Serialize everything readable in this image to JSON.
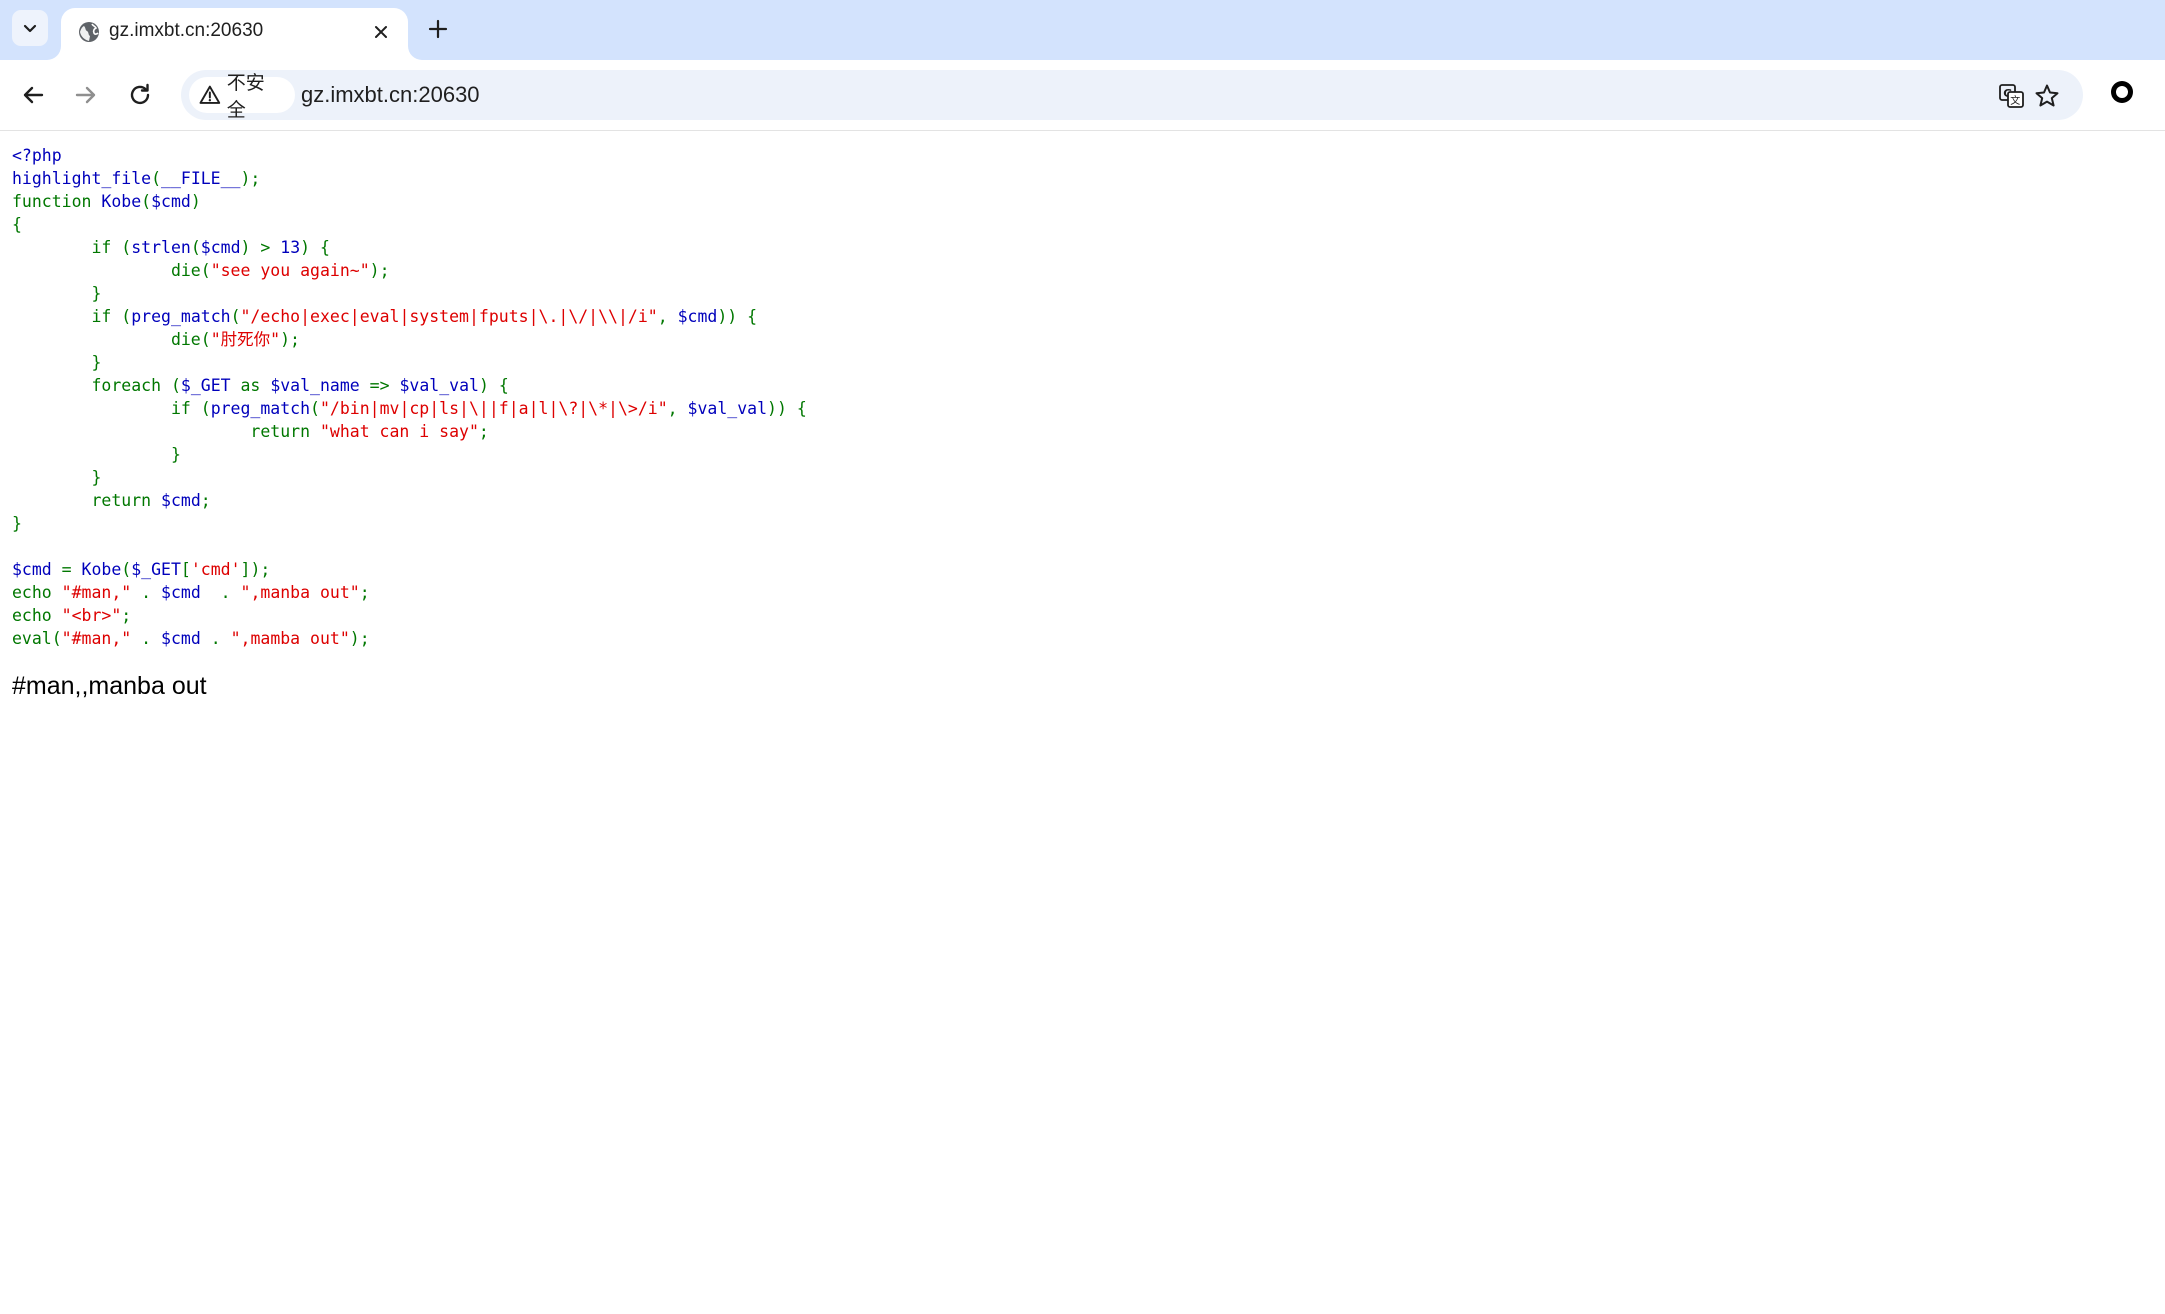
{
  "browser": {
    "tab": {
      "title": "gz.imxbt.cn:20630"
    },
    "address_bar": {
      "security_label": "不安全",
      "url": "gz.imxbt.cn:20630"
    },
    "icons": [
      "tab-search-icon",
      "globe-icon",
      "close-icon",
      "plus-icon",
      "back-icon",
      "forward-icon",
      "reload-icon",
      "warning-icon",
      "translate-icon",
      "star-icon",
      "profile-icon"
    ]
  },
  "colors": {
    "tabstrip_bg": "#d3e3fd",
    "omnibox_bg": "#edf2fa",
    "php_default": "#0000bb",
    "php_keyword": "#007700",
    "php_string": "#dd0000"
  },
  "code": {
    "lines": [
      [
        [
          "d",
          "<?php"
        ]
      ],
      [
        [
          "d",
          "highlight_file"
        ],
        [
          "k",
          "("
        ],
        [
          "d",
          "__FILE__"
        ],
        [
          "k",
          ");"
        ]
      ],
      [
        [
          "k",
          "function "
        ],
        [
          "d",
          "Kobe"
        ],
        [
          "k",
          "("
        ],
        [
          "d",
          "$cmd"
        ],
        [
          "k",
          ")"
        ]
      ],
      [
        [
          "k",
          "{"
        ]
      ],
      [
        [
          "k",
          "        if ("
        ],
        [
          "d",
          "strlen"
        ],
        [
          "k",
          "("
        ],
        [
          "d",
          "$cmd"
        ],
        [
          "k",
          ") > "
        ],
        [
          "d",
          "13"
        ],
        [
          "k",
          ") {"
        ]
      ],
      [
        [
          "k",
          "                die("
        ],
        [
          "s",
          "\"see you again~\""
        ],
        [
          "k",
          ");"
        ]
      ],
      [
        [
          "k",
          "        }"
        ]
      ],
      [
        [
          "k",
          "        if ("
        ],
        [
          "d",
          "preg_match"
        ],
        [
          "k",
          "("
        ],
        [
          "s",
          "\"/echo|exec|eval|system|fputs|\\.|\\/|\\\\|/i\""
        ],
        [
          "k",
          ", "
        ],
        [
          "d",
          "$cmd"
        ],
        [
          "k",
          ")) {"
        ]
      ],
      [
        [
          "k",
          "                die("
        ],
        [
          "s",
          "\"肘死你\""
        ],
        [
          "k",
          ");"
        ]
      ],
      [
        [
          "k",
          "        }"
        ]
      ],
      [
        [
          "k",
          "        foreach ("
        ],
        [
          "d",
          "$_GET "
        ],
        [
          "k",
          "as "
        ],
        [
          "d",
          "$val_name "
        ],
        [
          "k",
          "=> "
        ],
        [
          "d",
          "$val_val"
        ],
        [
          "k",
          ") {"
        ]
      ],
      [
        [
          "k",
          "                if ("
        ],
        [
          "d",
          "preg_match"
        ],
        [
          "k",
          "("
        ],
        [
          "s",
          "\"/bin|mv|cp|ls|\\||f|a|l|\\?|\\*|\\>/i\""
        ],
        [
          "k",
          ", "
        ],
        [
          "d",
          "$val_val"
        ],
        [
          "k",
          ")) {"
        ]
      ],
      [
        [
          "k",
          "                        return "
        ],
        [
          "s",
          "\"what can i say\""
        ],
        [
          "k",
          ";"
        ]
      ],
      [
        [
          "k",
          "                }"
        ]
      ],
      [
        [
          "k",
          "        }"
        ]
      ],
      [
        [
          "k",
          "        return "
        ],
        [
          "d",
          "$cmd"
        ],
        [
          "k",
          ";"
        ]
      ],
      [
        [
          "k",
          "}"
        ]
      ],
      [],
      [
        [
          "d",
          "$cmd "
        ],
        [
          "k",
          "= "
        ],
        [
          "d",
          "Kobe"
        ],
        [
          "k",
          "("
        ],
        [
          "d",
          "$_GET"
        ],
        [
          "k",
          "["
        ],
        [
          "s",
          "'cmd'"
        ],
        [
          "k",
          "]);"
        ]
      ],
      [
        [
          "k",
          "echo "
        ],
        [
          "s",
          "\"#man,\" "
        ],
        [
          "k",
          ". "
        ],
        [
          "d",
          "$cmd  "
        ],
        [
          "k",
          ". "
        ],
        [
          "s",
          "\",manba out\""
        ],
        [
          "k",
          ";"
        ]
      ],
      [
        [
          "k",
          "echo "
        ],
        [
          "s",
          "\"<br>\""
        ],
        [
          "k",
          ";"
        ]
      ],
      [
        [
          "k",
          "eval("
        ],
        [
          "s",
          "\"#man,\" "
        ],
        [
          "k",
          ". "
        ],
        [
          "d",
          "$cmd "
        ],
        [
          "k",
          ". "
        ],
        [
          "s",
          "\",mamba out\""
        ],
        [
          "k",
          ");"
        ]
      ]
    ]
  },
  "output": {
    "text": "#man,,manba out"
  }
}
